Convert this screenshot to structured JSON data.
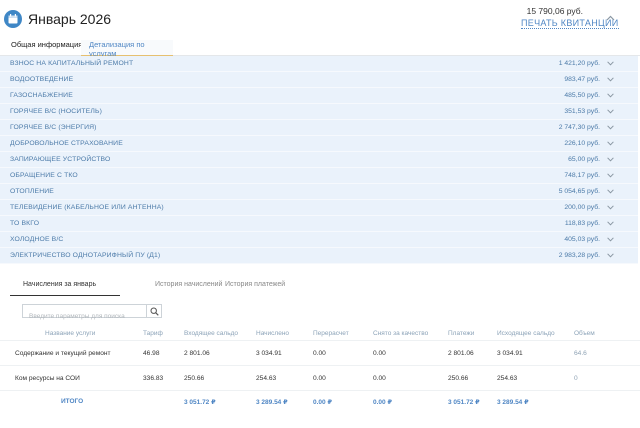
{
  "header": {
    "title": "Январь 2026",
    "total": "15 790,06 руб.",
    "print_label": "ПЕЧАТЬ КВИТАНЦИИ"
  },
  "tabs": {
    "general": "Общая информация",
    "detail": "Детализация по услугам"
  },
  "services": [
    {
      "name": "ВЗНОС НА КАПИТАЛЬНЫЙ РЕМОНТ",
      "amount": "1 421,20 руб."
    },
    {
      "name": "ВОДООТВЕДЕНИЕ",
      "amount": "983,47 руб."
    },
    {
      "name": "ГАЗОСНАБЖЕНИЕ",
      "amount": "485,50 руб."
    },
    {
      "name": "ГОРЯЧЕЕ В/С (НОСИТЕЛЬ)",
      "amount": "351,53 руб."
    },
    {
      "name": "ГОРЯЧЕЕ В/С (ЭНЕРГИЯ)",
      "amount": "2 747,30 руб."
    },
    {
      "name": "ДОБРОВОЛЬНОЕ СТРАХОВАНИЕ",
      "amount": "226,10 руб."
    },
    {
      "name": "ЗАПИРАЮЩЕЕ УСТРОЙСТВО",
      "amount": "65,00 руб."
    },
    {
      "name": "ОБРАЩЕНИЕ С ТКО",
      "amount": "748,17 руб."
    },
    {
      "name": "ОТОПЛЕНИЕ",
      "amount": "5 054,65 руб."
    },
    {
      "name": "ТЕЛЕВИДЕНИЕ (КАБЕЛЬНОЕ ИЛИ АНТЕННА)",
      "amount": "200,00 руб."
    },
    {
      "name": "ТО ВКГО",
      "amount": "118,83 руб."
    },
    {
      "name": "ХОЛОДНОЕ В/С",
      "amount": "405,03 руб."
    },
    {
      "name": "ЭЛЕКТРИЧЕСТВО ОДНОТАРИФНЫЙ ПУ (Д1)",
      "amount": "2 983,28 руб."
    }
  ],
  "subtabs": {
    "charges": "Начисления за январь",
    "history_charges": "История начислений",
    "history_payments": "История платежей"
  },
  "search": {
    "placeholder": "Введите параметры для поиска"
  },
  "table": {
    "headers": [
      "Название услуги",
      "Тариф",
      "Входящее сальдо",
      "Начислено",
      "Перерасчет",
      "Снято за качество",
      "Платежи",
      "Исходящее сальдо",
      "Объем"
    ],
    "rows": [
      [
        "Содержание и текущий ремонт",
        "46.98",
        "2 801.06",
        "3 034.91",
        "0.00",
        "0.00",
        "2 801.06",
        "3 034.91",
        "64.6"
      ],
      [
        "Ком ресурсы на СОИ",
        "336.83",
        "250.66",
        "254.63",
        "0.00",
        "0.00",
        "250.66",
        "254.63",
        "0"
      ]
    ],
    "footer": [
      "ИТОГО",
      "3 051.72 ₽",
      "3 289.54 ₽",
      "0.00 ₽",
      "0.00 ₽",
      "3 051.72 ₽",
      "3 289.54 ₽"
    ]
  },
  "colors": {
    "accent": "#4f86c4",
    "services_bg": "#eaf2fb",
    "active_tab_underline": "#e6c070"
  }
}
